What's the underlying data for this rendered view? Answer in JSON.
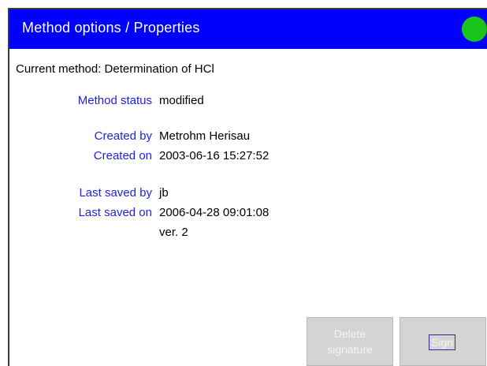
{
  "window": {
    "title": "Method options / Properties",
    "status_color": "#1bc41b",
    "title_bar_color": "#0000ff"
  },
  "current_method": "Current method: Determination of HCl",
  "properties": {
    "method_status": {
      "label": "Method status",
      "value": "modified"
    },
    "created_by": {
      "label": "Created by",
      "value": "Metrohm Herisau"
    },
    "created_on": {
      "label": "Created on",
      "value": "2003-06-16 15:27:52"
    },
    "last_saved_by": {
      "label": "Last saved by",
      "value": "jb"
    },
    "last_saved_on": {
      "label": "Last saved on",
      "value": "2006-04-28 09:01:08"
    },
    "version": "ver. 2"
  },
  "buttons": {
    "delete_signature_line1": "Delete",
    "delete_signature_line2": "signature",
    "sign": "Sign"
  },
  "colors": {
    "label_blue": "#2222dd",
    "disabled_button": "#d4d4d4"
  }
}
